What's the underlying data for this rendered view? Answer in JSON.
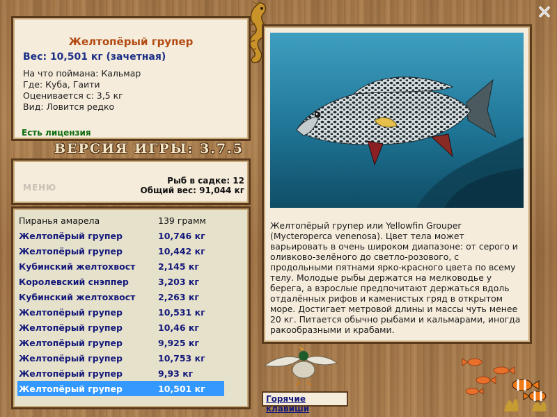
{
  "info": {
    "title": "Желтопёрый групер",
    "weight": "Вес: 10,501 кг (зачетная)",
    "bait": "На что поймана: Кальмар",
    "where": "Где: Куба, Гаити",
    "rated_from": "Оценивается с: 3,5 кг",
    "kind": "Вид: Ловится редко",
    "license": "Есть лицензия"
  },
  "version": "ВЕРСИЯ ИГРЫ: 3.7.5",
  "menu_label": "МЕНЮ",
  "summary": {
    "fish_in_keepnet": "Рыб в садке: 12",
    "total_weight": "Общий вес: 91,044 кг"
  },
  "catch_list": [
    {
      "name": "Пиранья амарела",
      "weight": "139 грамм",
      "style": "plain"
    },
    {
      "name": "Желтопёрый групер",
      "weight": "10,746 кг",
      "style": "bold"
    },
    {
      "name": "Желтопёрый групер",
      "weight": "10,442 кг",
      "style": "bold"
    },
    {
      "name": "Кубинский желтохвост",
      "weight": "2,145 кг",
      "style": "bold"
    },
    {
      "name": "Королевский снэппер",
      "weight": "3,203 кг",
      "style": "bold"
    },
    {
      "name": "Кубинский желтохвост",
      "weight": "2,263 кг",
      "style": "bold"
    },
    {
      "name": "Желтопёрый групер",
      "weight": "10,531 кг",
      "style": "bold"
    },
    {
      "name": "Желтопёрый групер",
      "weight": "10,46 кг",
      "style": "bold"
    },
    {
      "name": "Желтопёрый групер",
      "weight": "9,925 кг",
      "style": "bold"
    },
    {
      "name": "Желтопёрый групер",
      "weight": "10,753 кг",
      "style": "bold"
    },
    {
      "name": "Желтопёрый групер",
      "weight": "9,93 кг",
      "style": "bold"
    },
    {
      "name": "Желтопёрый групер",
      "weight": "10,501 кг",
      "style": "sel"
    }
  ],
  "description": "Желтопёрый групер или Yellowfin Grouper (Mycteroperca venenosa). Цвет тела может варьировать в очень широком диапазоне: от серого и оливково-зелёного до светло-розового, с продольными пятнами ярко-красного цвета по всему телу. Молодые рыбы держатся на мелководье у берега, а взрослые предпочитают держаться вдоль отдалённых рифов и каменистых гряд в открытом море. Достигает метровой длины и массы чуть менее 20 кг. Питается обычно рыбами и кальмарами, иногда ракообразными и крабами.",
  "hotkeys_label": "Горячие клавиши",
  "icons": {
    "close": "close-icon",
    "seahorse": "seahorse-icon",
    "duck": "duck-icon",
    "fish_school": "goldfish-icon",
    "clownfish": "clownfish-icon"
  },
  "colors": {
    "title": "#b34a12",
    "weight_text": "#1a2e86",
    "license": "#0d6b0d",
    "selected_row": "#3399ff",
    "panel_bg": "#f5ecdc",
    "frame": "#5a3a1c"
  }
}
